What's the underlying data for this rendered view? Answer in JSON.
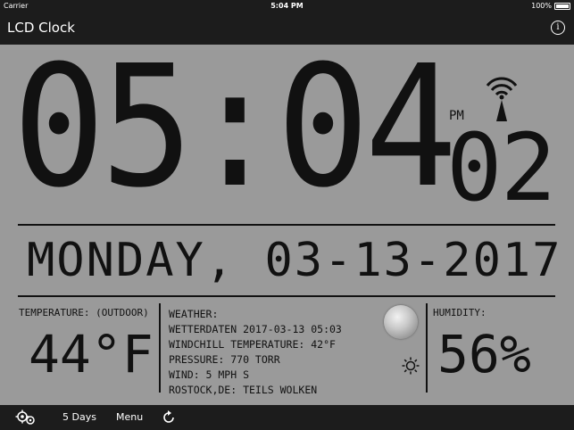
{
  "status_bar": {
    "carrier": "Carrier",
    "time": "5:04 PM",
    "battery": "100%"
  },
  "nav": {
    "title": "LCD Clock",
    "info_icon": "info-icon"
  },
  "clock": {
    "hours_minutes": "05:04",
    "ampm": "PM",
    "seconds": "02",
    "signal_icon": "radio-signal-icon"
  },
  "date": {
    "text": "MONDAY, 03-13-2017"
  },
  "temperature": {
    "label": "TEMPERATURE: (OUTDOOR)",
    "value": "44°F"
  },
  "weather": {
    "label": "WEATHER:",
    "lines": [
      "WETTERDATEN 2017-03-13 05:03",
      "WINDCHILL TEMPERATURE: 42°F",
      "PRESSURE: 770 TORR",
      "WIND: 5 MPH S",
      "ROSTOCK,DE: TEILS WOLKEN"
    ],
    "moon_icon": "moon-icon",
    "sun_icon": "sun-icon"
  },
  "humidity": {
    "label": "HUMIDITY:",
    "value": "56%"
  },
  "toolbar": {
    "settings_icon": "gears-icon",
    "days_label": "5 Days",
    "menu_label": "Menu",
    "refresh_icon": "refresh-icon"
  }
}
